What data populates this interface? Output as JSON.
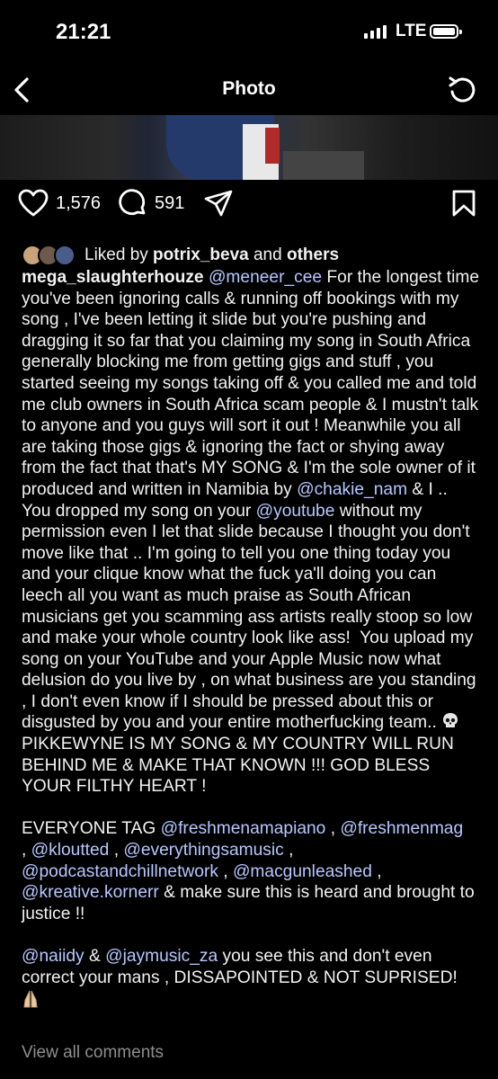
{
  "status_bar": {
    "time": "21:21",
    "network": "LTE",
    "signal_bars": 4,
    "battery_level": 1.0
  },
  "nav": {
    "title": "Photo",
    "back_icon": "chevron-left-icon",
    "refresh_icon": "refresh-icon"
  },
  "actions": {
    "like_count": "1,576",
    "comment_count": "591"
  },
  "likes": {
    "prefix": "Liked by ",
    "user": "potrix_beva",
    "and": " and ",
    "others": "others"
  },
  "caption": {
    "username": "mega_slaughterhouze",
    "segments": [
      {
        "type": "mention",
        "text": "@meneer_cee"
      },
      {
        "type": "text",
        "text": " For the longest time you've been ignoring calls & running off bookings with my song , I've been letting it slide but you're pushing and dragging it so far that you claiming my song in South Africa generally blocking me from getting gigs and stuff , you started seeing my songs taking off & you called me and told me club owners in South Africa scam people & I mustn't talk to anyone and you guys will sort it out ! Meanwhile you all are taking those gigs & ignoring the fact or shying away from the fact that that's MY SONG & I'm the sole owner of it produced and written in Namibia by "
      },
      {
        "type": "mention",
        "text": "@chakie_nam"
      },
      {
        "type": "text",
        "text": " & I .. You dropped my song on your "
      },
      {
        "type": "mention",
        "text": "@youtube"
      },
      {
        "type": "text",
        "text": " without my permission even I let that slide because I thought you don't move like that .. I'm going to tell you one thing today you and your clique know what the fuck ya'll doing you can leech all you want as much praise as South African musicians get you scamming ass artists really stoop so low and make your whole country look like ass!  You upload my song on your YouTube and your Apple Music now what delusion do you live by , on what business are you standing , I don't even know if I should be pressed about this or disgusted by you and your entire motherfucking team.. "
      },
      {
        "type": "emoji",
        "text": "skull"
      },
      {
        "type": "text",
        "text": "  PIKKEWYNE IS MY SONG & MY COUNTRY WILL RUN BEHIND ME & MAKE THAT KNOWN !!! GOD BLESS YOUR FILTHY HEART !\n\nEVERYONE TAG "
      },
      {
        "type": "mention",
        "text": "@freshmenamapiano"
      },
      {
        "type": "text",
        "text": " , "
      },
      {
        "type": "mention",
        "text": "@freshmenmag"
      },
      {
        "type": "text",
        "text": "\n, "
      },
      {
        "type": "mention",
        "text": "@kloutted"
      },
      {
        "type": "text",
        "text": " , "
      },
      {
        "type": "mention",
        "text": "@everythingsamusic"
      },
      {
        "type": "text",
        "text": " ,\n"
      },
      {
        "type": "mention",
        "text": "@podcastandchillnetwork"
      },
      {
        "type": "text",
        "text": " , "
      },
      {
        "type": "mention",
        "text": "@macgunleashed"
      },
      {
        "type": "text",
        "text": " ,\n"
      },
      {
        "type": "mention",
        "text": "@kreative.kornerr"
      },
      {
        "type": "text",
        "text": " & make sure this is heard and brought to justice !!\n\n"
      },
      {
        "type": "mention",
        "text": "@naiidy"
      },
      {
        "type": "text",
        "text": " & "
      },
      {
        "type": "mention",
        "text": "@jaymusic_za"
      },
      {
        "type": "text",
        "text": " you see this and don't even correct your mans , DISSAPOINTED & NOT SUPRISED!\n"
      },
      {
        "type": "emoji",
        "text": "folded-hands"
      }
    ]
  },
  "view_all_comments": "View all comments",
  "colors": {
    "background": "#000000",
    "text": "#f2f2f2",
    "mention": "#b7c7ff",
    "muted": "#8e8e8e"
  }
}
